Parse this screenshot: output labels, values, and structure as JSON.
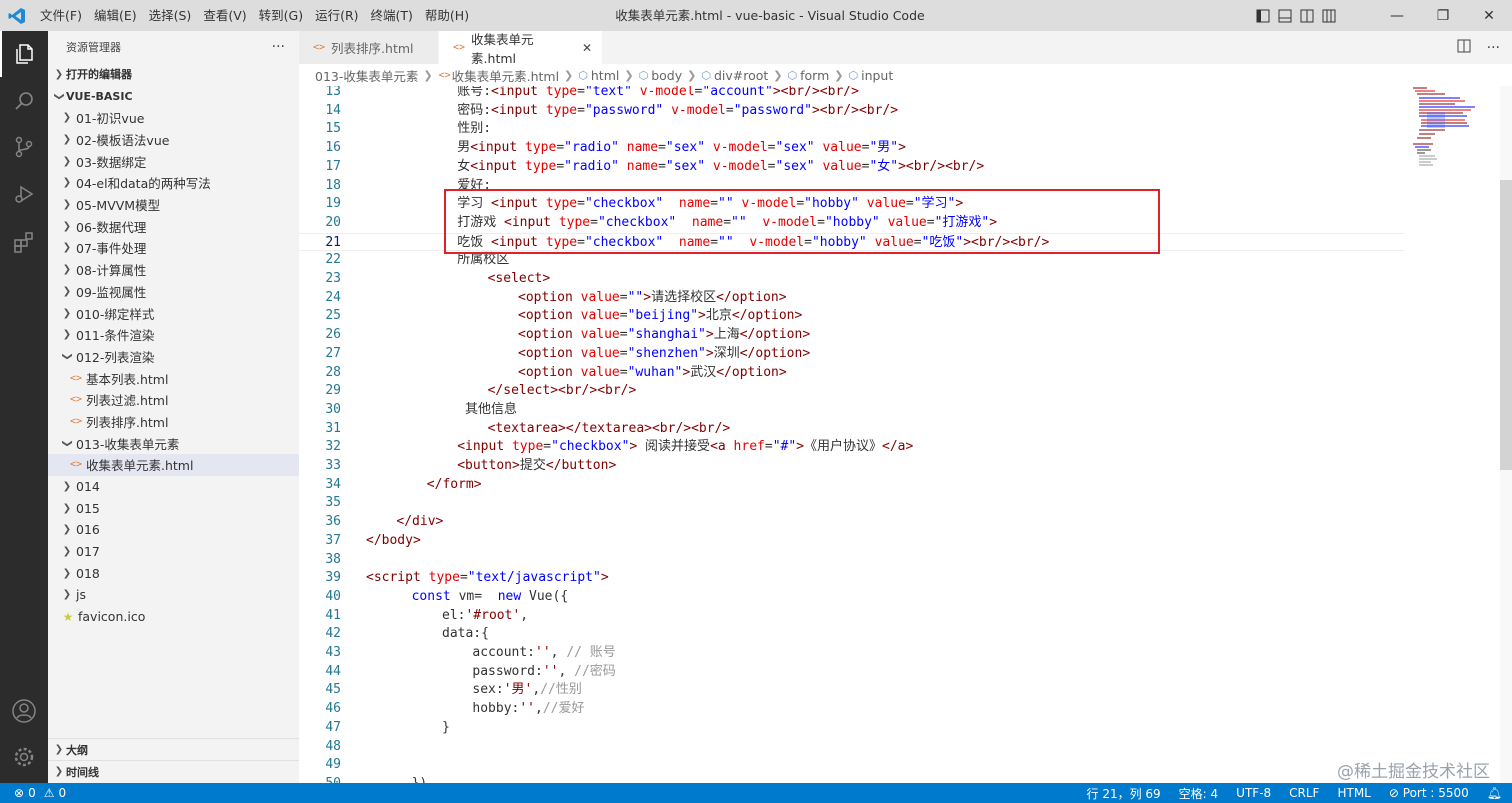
{
  "titlebar": {
    "menu": [
      "文件(F)",
      "编辑(E)",
      "选择(S)",
      "查看(V)",
      "转到(G)",
      "运行(R)",
      "终端(T)",
      "帮助(H)"
    ],
    "title": "收集表单元素.html - vue-basic - Visual Studio Code"
  },
  "activitybar": {
    "icons": [
      "explorer-icon",
      "search-icon",
      "source-control-icon",
      "run-debug-icon",
      "extensions-icon",
      "account-icon",
      "settings-gear-icon"
    ]
  },
  "sidebar": {
    "header": "资源管理器",
    "more": "···",
    "open_editors": "打开的编辑器",
    "root": "VUE-BASIC",
    "items": [
      {
        "label": "01-初识vue",
        "type": "folder"
      },
      {
        "label": "02-模板语法vue",
        "type": "folder"
      },
      {
        "label": "03-数据绑定",
        "type": "folder"
      },
      {
        "label": "04-el和data的两种写法",
        "type": "folder"
      },
      {
        "label": "05-MVVM模型",
        "type": "folder"
      },
      {
        "label": "06-数据代理",
        "type": "folder"
      },
      {
        "label": "07-事件处理",
        "type": "folder"
      },
      {
        "label": "08-计算属性",
        "type": "folder"
      },
      {
        "label": "09-监视属性",
        "type": "folder"
      },
      {
        "label": "010-绑定样式",
        "type": "folder"
      },
      {
        "label": "011-条件渲染",
        "type": "folder"
      },
      {
        "label": "012-列表渲染",
        "type": "folder-open"
      },
      {
        "label": "基本列表.html",
        "type": "file"
      },
      {
        "label": "列表过滤.html",
        "type": "file"
      },
      {
        "label": "列表排序.html",
        "type": "file"
      },
      {
        "label": "013-收集表单元素",
        "type": "folder-open"
      },
      {
        "label": "收集表单元素.html",
        "type": "file-selected"
      },
      {
        "label": "014",
        "type": "folder"
      },
      {
        "label": "015",
        "type": "folder"
      },
      {
        "label": "016",
        "type": "folder"
      },
      {
        "label": "017",
        "type": "folder"
      },
      {
        "label": "018",
        "type": "folder"
      },
      {
        "label": "js",
        "type": "folder"
      },
      {
        "label": "favicon.ico",
        "type": "favicon"
      }
    ],
    "outline": "大纲",
    "timeline": "时间线"
  },
  "tabs": [
    {
      "label": "列表排序.html",
      "active": false
    },
    {
      "label": "收集表单元素.html",
      "active": true
    }
  ],
  "breadcrumb": [
    "013-收集表单元素",
    "收集表单元素.html",
    "html",
    "body",
    "div#root",
    "form",
    "input"
  ],
  "code": [
    {
      "n": "13",
      "indent": 6,
      "tokens": [
        [
          "p",
          "账号:"
        ],
        [
          "t",
          "<input "
        ],
        [
          "a",
          "type"
        ],
        [
          "p",
          "="
        ],
        [
          "s",
          "\"text\""
        ],
        [
          "p",
          " "
        ],
        [
          "a",
          "v-model"
        ],
        [
          "p",
          "="
        ],
        [
          "s",
          "\"account\""
        ],
        [
          "t",
          ">"
        ],
        [
          "t",
          "<br/>"
        ],
        [
          "t",
          "<br/>"
        ]
      ]
    },
    {
      "n": "14",
      "indent": 6,
      "tokens": [
        [
          "p",
          "密码:"
        ],
        [
          "t",
          "<input "
        ],
        [
          "a",
          "type"
        ],
        [
          "p",
          "="
        ],
        [
          "s",
          "\"password\""
        ],
        [
          "p",
          " "
        ],
        [
          "a",
          "v-model"
        ],
        [
          "p",
          "="
        ],
        [
          "s",
          "\"password\""
        ],
        [
          "t",
          ">"
        ],
        [
          "t",
          "<br/>"
        ],
        [
          "t",
          "<br/>"
        ]
      ]
    },
    {
      "n": "15",
      "indent": 6,
      "tokens": [
        [
          "p",
          "性别:"
        ]
      ]
    },
    {
      "n": "16",
      "indent": 6,
      "tokens": [
        [
          "p",
          "男"
        ],
        [
          "t",
          "<input "
        ],
        [
          "a",
          "type"
        ],
        [
          "p",
          "="
        ],
        [
          "s",
          "\"radio\""
        ],
        [
          "p",
          " "
        ],
        [
          "a",
          "name"
        ],
        [
          "p",
          "="
        ],
        [
          "s",
          "\"sex\""
        ],
        [
          "p",
          " "
        ],
        [
          "a",
          "v-model"
        ],
        [
          "p",
          "="
        ],
        [
          "s",
          "\"sex\""
        ],
        [
          "p",
          " "
        ],
        [
          "a",
          "value"
        ],
        [
          "p",
          "="
        ],
        [
          "s",
          "\"男\""
        ],
        [
          "t",
          ">"
        ]
      ]
    },
    {
      "n": "17",
      "indent": 6,
      "tokens": [
        [
          "p",
          "女"
        ],
        [
          "t",
          "<input "
        ],
        [
          "a",
          "type"
        ],
        [
          "p",
          "="
        ],
        [
          "s",
          "\"radio\""
        ],
        [
          "p",
          " "
        ],
        [
          "a",
          "name"
        ],
        [
          "p",
          "="
        ],
        [
          "s",
          "\"sex\""
        ],
        [
          "p",
          " "
        ],
        [
          "a",
          "v-model"
        ],
        [
          "p",
          "="
        ],
        [
          "s",
          "\"sex\""
        ],
        [
          "p",
          " "
        ],
        [
          "a",
          "value"
        ],
        [
          "p",
          "="
        ],
        [
          "s",
          "\"女\""
        ],
        [
          "t",
          ">"
        ],
        [
          "t",
          "<br/>"
        ],
        [
          "t",
          "<br/>"
        ]
      ]
    },
    {
      "n": "18",
      "indent": 6,
      "tokens": [
        [
          "p",
          "爱好:"
        ]
      ]
    },
    {
      "n": "19",
      "indent": 6,
      "tokens": [
        [
          "p",
          "学习 "
        ],
        [
          "t",
          "<input "
        ],
        [
          "a",
          "type"
        ],
        [
          "p",
          "="
        ],
        [
          "s",
          "\"checkbox\""
        ],
        [
          "p",
          "  "
        ],
        [
          "a",
          "name"
        ],
        [
          "p",
          "="
        ],
        [
          "s",
          "\"\""
        ],
        [
          "p",
          " "
        ],
        [
          "a",
          "v-model"
        ],
        [
          "p",
          "="
        ],
        [
          "s",
          "\"hobby\""
        ],
        [
          "p",
          " "
        ],
        [
          "a",
          "value"
        ],
        [
          "p",
          "="
        ],
        [
          "s",
          "\"学习\""
        ],
        [
          "t",
          ">"
        ]
      ]
    },
    {
      "n": "20",
      "indent": 6,
      "tokens": [
        [
          "p",
          "打游戏 "
        ],
        [
          "t",
          "<input "
        ],
        [
          "a",
          "type"
        ],
        [
          "p",
          "="
        ],
        [
          "s",
          "\"checkbox\""
        ],
        [
          "p",
          "  "
        ],
        [
          "a",
          "name"
        ],
        [
          "p",
          "="
        ],
        [
          "s",
          "\"\""
        ],
        [
          "p",
          "  "
        ],
        [
          "a",
          "v-model"
        ],
        [
          "p",
          "="
        ],
        [
          "s",
          "\"hobby\""
        ],
        [
          "p",
          " "
        ],
        [
          "a",
          "value"
        ],
        [
          "p",
          "="
        ],
        [
          "s",
          "\"打游戏\""
        ],
        [
          "t",
          ">"
        ]
      ]
    },
    {
      "n": "21",
      "indent": 6,
      "current": true,
      "tokens": [
        [
          "p",
          "吃饭 "
        ],
        [
          "t",
          "<input "
        ],
        [
          "a",
          "type"
        ],
        [
          "p",
          "="
        ],
        [
          "s",
          "\"checkbox\""
        ],
        [
          "p",
          "  "
        ],
        [
          "a",
          "name"
        ],
        [
          "p",
          "="
        ],
        [
          "s",
          "\"\""
        ],
        [
          "p",
          "  "
        ],
        [
          "a",
          "v-model"
        ],
        [
          "p",
          "="
        ],
        [
          "s",
          "\"hobby\""
        ],
        [
          "p",
          " "
        ],
        [
          "a",
          "value"
        ],
        [
          "p",
          "="
        ],
        [
          "s",
          "\"吃饭\""
        ],
        [
          "t",
          ">"
        ],
        [
          "t",
          "<br/>"
        ],
        [
          "t",
          "<br/>"
        ]
      ]
    },
    {
      "n": "22",
      "indent": 6,
      "tokens": [
        [
          "p",
          "所属校区"
        ]
      ]
    },
    {
      "n": "23",
      "indent": 8,
      "tokens": [
        [
          "t",
          "<select>"
        ]
      ]
    },
    {
      "n": "24",
      "indent": 10,
      "tokens": [
        [
          "t",
          "<option "
        ],
        [
          "a",
          "value"
        ],
        [
          "p",
          "="
        ],
        [
          "s",
          "\"\""
        ],
        [
          "t",
          ">"
        ],
        [
          "p",
          "请选择校区"
        ],
        [
          "t",
          "</option>"
        ]
      ]
    },
    {
      "n": "25",
      "indent": 10,
      "tokens": [
        [
          "t",
          "<option "
        ],
        [
          "a",
          "value"
        ],
        [
          "p",
          "="
        ],
        [
          "s",
          "\"beijing\""
        ],
        [
          "t",
          ">"
        ],
        [
          "p",
          "北京"
        ],
        [
          "t",
          "</option>"
        ]
      ]
    },
    {
      "n": "26",
      "indent": 10,
      "tokens": [
        [
          "t",
          "<option "
        ],
        [
          "a",
          "value"
        ],
        [
          "p",
          "="
        ],
        [
          "s",
          "\"shanghai\""
        ],
        [
          "t",
          ">"
        ],
        [
          "p",
          "上海"
        ],
        [
          "t",
          "</option>"
        ]
      ]
    },
    {
      "n": "27",
      "indent": 10,
      "tokens": [
        [
          "t",
          "<option "
        ],
        [
          "a",
          "value"
        ],
        [
          "p",
          "="
        ],
        [
          "s",
          "\"shenzhen\""
        ],
        [
          "t",
          ">"
        ],
        [
          "p",
          "深圳"
        ],
        [
          "t",
          "</option>"
        ]
      ]
    },
    {
      "n": "28",
      "indent": 10,
      "tokens": [
        [
          "t",
          "<option "
        ],
        [
          "a",
          "value"
        ],
        [
          "p",
          "="
        ],
        [
          "s",
          "\"wuhan\""
        ],
        [
          "t",
          ">"
        ],
        [
          "p",
          "武汉"
        ],
        [
          "t",
          "</option>"
        ]
      ]
    },
    {
      "n": "29",
      "indent": 8,
      "tokens": [
        [
          "t",
          "</select>"
        ],
        [
          "t",
          "<br/>"
        ],
        [
          "t",
          "<br/>"
        ]
      ]
    },
    {
      "n": "30",
      "indent": 6,
      "tokens": [
        [
          "p",
          " 其他信息"
        ]
      ]
    },
    {
      "n": "31",
      "indent": 8,
      "tokens": [
        [
          "t",
          "<textarea>"
        ],
        [
          "t",
          "</textarea>"
        ],
        [
          "t",
          "<br/>"
        ],
        [
          "t",
          "<br/>"
        ]
      ]
    },
    {
      "n": "32",
      "indent": 6,
      "tokens": [
        [
          "t",
          "<input "
        ],
        [
          "a",
          "type"
        ],
        [
          "p",
          "="
        ],
        [
          "s",
          "\"checkbox\""
        ],
        [
          "t",
          ">"
        ],
        [
          "p",
          " 阅读并接受"
        ],
        [
          "t",
          "<a "
        ],
        [
          "a",
          "href"
        ],
        [
          "p",
          "="
        ],
        [
          "s",
          "\"#\""
        ],
        [
          "t",
          ">"
        ],
        [
          "p",
          "《用户协议》"
        ],
        [
          "t",
          "</a>"
        ]
      ]
    },
    {
      "n": "33",
      "indent": 6,
      "tokens": [
        [
          "t",
          "<button>"
        ],
        [
          "p",
          "提交"
        ],
        [
          "t",
          "</button>"
        ]
      ]
    },
    {
      "n": "34",
      "indent": 4,
      "tokens": [
        [
          "t",
          "</form>"
        ]
      ]
    },
    {
      "n": "35",
      "indent": 0,
      "tokens": []
    },
    {
      "n": "36",
      "indent": 2,
      "tokens": [
        [
          "t",
          "</div>"
        ]
      ]
    },
    {
      "n": "37",
      "indent": 0,
      "tokens": [
        [
          "t",
          "</body>"
        ]
      ]
    },
    {
      "n": "38",
      "indent": 0,
      "tokens": []
    },
    {
      "n": "39",
      "indent": 0,
      "tokens": [
        [
          "t",
          "<script "
        ],
        [
          "a",
          "type"
        ],
        [
          "p",
          "="
        ],
        [
          "s",
          "\"text/javascript\""
        ],
        [
          "t",
          ">"
        ]
      ]
    },
    {
      "n": "40",
      "indent": 3,
      "tokens": [
        [
          "k",
          "const "
        ],
        [
          "p",
          "vm=  "
        ],
        [
          "k",
          "new "
        ],
        [
          "p",
          "Vue({"
        ]
      ]
    },
    {
      "n": "41",
      "indent": 5,
      "tokens": [
        [
          "p",
          "el:"
        ],
        [
          "t",
          "'#root'"
        ],
        [
          "p",
          ","
        ]
      ]
    },
    {
      "n": "42",
      "indent": 5,
      "tokens": [
        [
          "p",
          "data:{"
        ]
      ]
    },
    {
      "n": "43",
      "indent": 7,
      "tokens": [
        [
          "p",
          "account:"
        ],
        [
          "t",
          "''"
        ],
        [
          "p",
          ", "
        ],
        [
          "g",
          "// 账号"
        ]
      ]
    },
    {
      "n": "44",
      "indent": 7,
      "tokens": [
        [
          "p",
          "password:"
        ],
        [
          "t",
          "''"
        ],
        [
          "p",
          ", "
        ],
        [
          "g",
          "//密码"
        ]
      ]
    },
    {
      "n": "45",
      "indent": 7,
      "tokens": [
        [
          "p",
          "sex:"
        ],
        [
          "t",
          "'男'"
        ],
        [
          "p",
          ","
        ],
        [
          "g",
          "//性别"
        ]
      ]
    },
    {
      "n": "46",
      "indent": 7,
      "tokens": [
        [
          "p",
          "hobby:"
        ],
        [
          "t",
          "''"
        ],
        [
          "p",
          ","
        ],
        [
          "g",
          "//爱好"
        ]
      ]
    },
    {
      "n": "47",
      "indent": 5,
      "tokens": [
        [
          "p",
          "}"
        ]
      ]
    },
    {
      "n": "48",
      "indent": 0,
      "tokens": []
    },
    {
      "n": "49",
      "indent": 0,
      "tokens": []
    },
    {
      "n": "50",
      "indent": 3,
      "tokens": [
        [
          "p",
          "})"
        ]
      ]
    }
  ],
  "statusbar": {
    "errors": "0",
    "warnings": "0",
    "position": "行 21，列 69",
    "spaces": "空格: 4",
    "encoding": "UTF-8",
    "eol": "CRLF",
    "language": "HTML",
    "port": "Port : 5500"
  },
  "watermark": "@稀土掘金技术社区",
  "colors": {
    "activity_bar": "#2c2c2c",
    "status_bar": "#007acc",
    "highlight_box": "#e0202a",
    "tag": "#800000",
    "attr": "#e50000",
    "string": "#0000ff"
  }
}
